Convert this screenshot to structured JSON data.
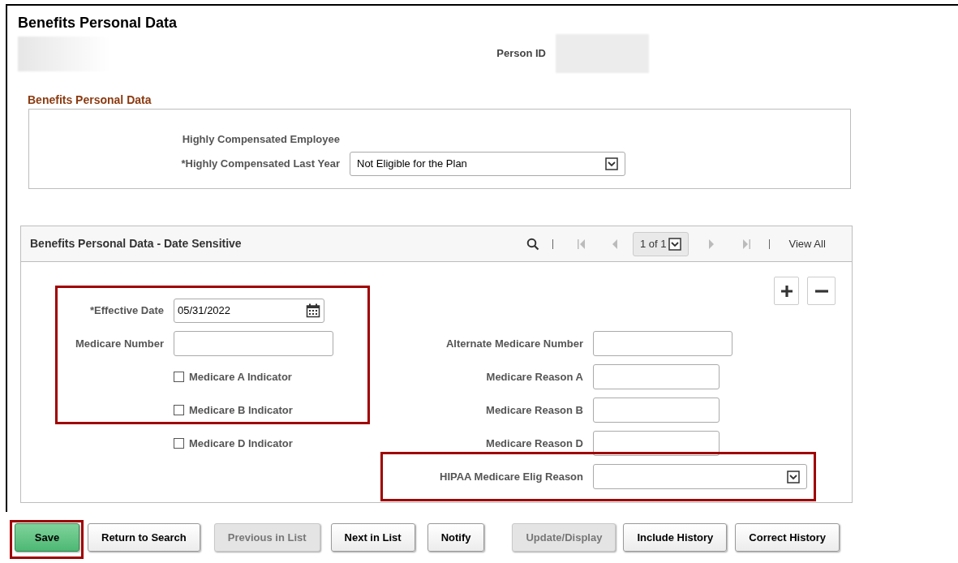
{
  "page_title": "Benefits Personal Data",
  "person_id_label": "Person ID",
  "section": {
    "title": "Benefits Personal Data",
    "fields": [
      {
        "kind": "text",
        "label": "Highly Compensated Employee"
      },
      {
        "kind": "select",
        "label": "*Highly Compensated Last Year",
        "value": "Not Eligible for the Plan"
      }
    ]
  },
  "group": {
    "title": "Benefits Personal Data - Date Sensitive",
    "counter": "1 of 1",
    "view_all": "View All",
    "left_fields": [
      {
        "kind": "date",
        "label": "*Effective Date",
        "value": "05/31/2022"
      },
      {
        "kind": "text",
        "label": "Medicare Number"
      },
      {
        "kind": "checkbox",
        "label": "Medicare A Indicator",
        "checked": false
      },
      {
        "kind": "checkbox",
        "label": "Medicare B Indicator",
        "checked": false
      },
      {
        "kind": "checkbox",
        "label": "Medicare D Indicator",
        "checked": false
      }
    ],
    "right_fields": [
      {
        "kind": "text",
        "label": "Alternate Medicare Number"
      },
      {
        "kind": "text",
        "label": "Medicare Reason A"
      },
      {
        "kind": "text",
        "label": "Medicare Reason B"
      },
      {
        "kind": "text",
        "label": "Medicare Reason D"
      },
      {
        "kind": "select",
        "label": "HIPAA Medicare Elig Reason"
      }
    ]
  },
  "buttons": [
    {
      "label": "Save",
      "kind": "primary",
      "disabled": false
    },
    {
      "label": "Return to Search",
      "kind": "default",
      "disabled": false
    },
    {
      "label": "Previous in List",
      "kind": "default",
      "disabled": true
    },
    {
      "label": "Next in List",
      "kind": "default",
      "disabled": false
    },
    {
      "label": "Notify",
      "kind": "default",
      "disabled": false
    },
    {
      "label": "Update/Display",
      "kind": "default",
      "disabled": true
    },
    {
      "label": "Include History",
      "kind": "default",
      "disabled": false
    },
    {
      "label": "Correct History",
      "kind": "default",
      "disabled": false
    }
  ]
}
